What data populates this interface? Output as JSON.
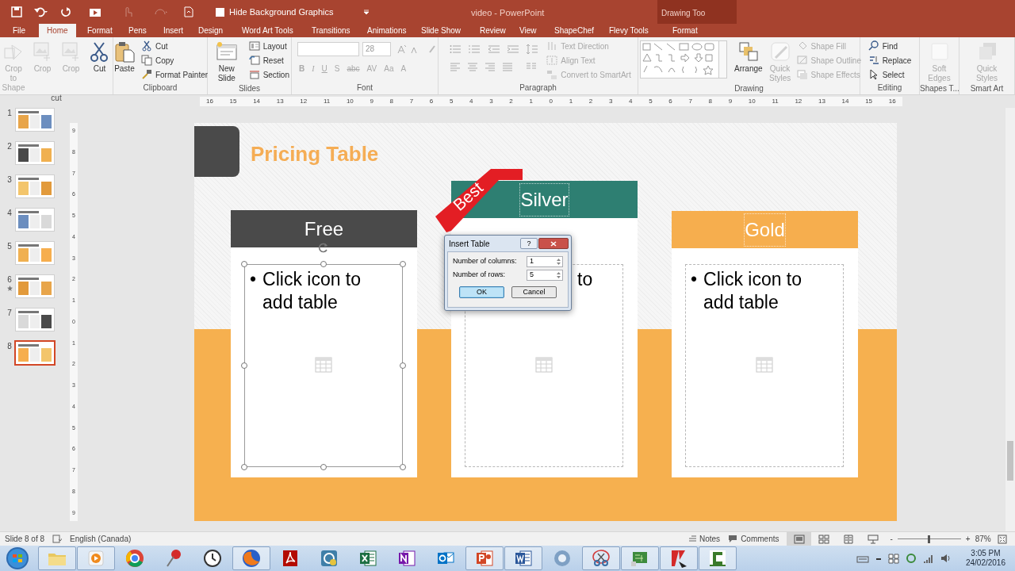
{
  "title_bar": {
    "hide_background": {
      "label": "Hide Background Graphics",
      "checked": false
    },
    "title": "video - PowerPoint",
    "contextual": "Drawing Too"
  },
  "tabs": [
    {
      "label": "File",
      "selected": false
    },
    {
      "label": "Home",
      "selected": true
    },
    {
      "label": "Format",
      "selected": false
    },
    {
      "label": "Pens",
      "selected": false
    },
    {
      "label": "Insert",
      "selected": false
    },
    {
      "label": "Design",
      "selected": false
    },
    {
      "label": "Word Art Tools",
      "selected": false
    },
    {
      "label": "Transitions",
      "selected": false
    },
    {
      "label": "Animations",
      "selected": false
    },
    {
      "label": "Slide Show",
      "selected": false
    },
    {
      "label": "Review",
      "selected": false
    },
    {
      "label": "View",
      "selected": false
    },
    {
      "label": "ShapeChef",
      "selected": false
    },
    {
      "label": "Flevy Tools",
      "selected": false
    },
    {
      "label": "Format",
      "selected": false
    }
  ],
  "ribbon": [
    {
      "label": "cut",
      "items": [
        {
          "kind": "large",
          "label": "Crop to Shape",
          "disabled": true
        },
        {
          "kind": "large",
          "label": "Crop",
          "disabled": true
        },
        {
          "kind": "large",
          "label": "Crop",
          "disabled": true
        },
        {
          "kind": "large",
          "label": "Cut",
          "disabled": false
        }
      ]
    },
    {
      "label": "Clipboard",
      "items": [
        {
          "kind": "large",
          "label": "Paste",
          "disabled": false
        },
        {
          "kind": "small",
          "label": "Cut",
          "disabled": false
        },
        {
          "kind": "small",
          "label": "Copy",
          "disabled": false
        },
        {
          "kind": "small",
          "label": "Format Painter",
          "disabled": false
        }
      ]
    },
    {
      "label": "Slides",
      "items": [
        {
          "kind": "large",
          "label": "New Slide",
          "disabled": false
        },
        {
          "kind": "small",
          "label": "Layout",
          "disabled": false
        },
        {
          "kind": "small",
          "label": "Reset",
          "disabled": false
        },
        {
          "kind": "small",
          "label": "Section",
          "disabled": false
        }
      ]
    },
    {
      "label": "Font",
      "kind": "font",
      "font_size": "28",
      "buttons": [
        "B",
        "I",
        "U",
        "S",
        "abc",
        "AV",
        "Aa",
        "A"
      ]
    },
    {
      "label": "Paragraph",
      "kind": "paragraph",
      "items": [
        {
          "kind": "small",
          "label": "Text Direction",
          "disabled": true
        },
        {
          "kind": "small",
          "label": "Align Text",
          "disabled": true
        },
        {
          "kind": "small",
          "label": "Convert to SmartArt",
          "disabled": true
        }
      ]
    },
    {
      "label": "Drawing",
      "kind": "drawing",
      "items": [
        {
          "kind": "large",
          "label": "Arrange",
          "disabled": false
        },
        {
          "kind": "large",
          "label": "Quick Styles",
          "disabled": true
        },
        {
          "kind": "small",
          "label": "Shape Fill",
          "disabled": true
        },
        {
          "kind": "small",
          "label": "Shape Outline",
          "disabled": true
        },
        {
          "kind": "small",
          "label": "Shape Effects",
          "disabled": true
        }
      ]
    },
    {
      "label": "Editing",
      "items": [
        {
          "kind": "small",
          "label": "Find",
          "disabled": false
        },
        {
          "kind": "small",
          "label": "Replace",
          "disabled": false
        },
        {
          "kind": "small",
          "label": "Select",
          "disabled": false
        }
      ]
    },
    {
      "label": "Shapes T...",
      "items": [
        {
          "kind": "large",
          "label": "Soft Edges",
          "disabled": true
        }
      ]
    },
    {
      "label": "Smart Art",
      "items": [
        {
          "kind": "large",
          "label": "Quick Styles",
          "disabled": true
        }
      ]
    }
  ],
  "ruler": {
    "horizontal": [
      "16",
      "15",
      "14",
      "13",
      "12",
      "11",
      "10",
      "9",
      "8",
      "7",
      "6",
      "5",
      "4",
      "3",
      "2",
      "1",
      "0",
      "1",
      "2",
      "3",
      "4",
      "5",
      "6",
      "7",
      "8",
      "9",
      "10",
      "11",
      "12",
      "13",
      "14",
      "15",
      "16"
    ],
    "vertical": [
      "9",
      "8",
      "7",
      "6",
      "5",
      "4",
      "3",
      "2",
      "1",
      "0",
      "1",
      "2",
      "3",
      "4",
      "5",
      "6",
      "7",
      "8",
      "9"
    ]
  },
  "slides": [
    {
      "number": "1",
      "selected": false,
      "animated": false
    },
    {
      "number": "2",
      "selected": false,
      "animated": false
    },
    {
      "number": "3",
      "selected": false,
      "animated": false
    },
    {
      "number": "4",
      "selected": false,
      "animated": false
    },
    {
      "number": "5",
      "selected": false,
      "animated": false
    },
    {
      "number": "6",
      "selected": false,
      "animated": true
    },
    {
      "number": "7",
      "selected": false,
      "animated": false
    },
    {
      "number": "8",
      "selected": true,
      "animated": false
    }
  ],
  "slide": {
    "title": "Pricing Table",
    "columns": [
      {
        "name": "Free",
        "color": "#4a4a4a",
        "bullet": "•",
        "placeholder": "Click icon to add table",
        "selected": true
      },
      {
        "name": "Silver",
        "color": "#2e7f72",
        "placeholder": "to",
        "badge": "Best",
        "selected": false
      },
      {
        "name": "Gold",
        "color": "#f6ae4e",
        "bullet": "•",
        "placeholder": "Click icon to add table",
        "selected": false
      }
    ]
  },
  "dialog": {
    "title": "Insert Table",
    "help": "?",
    "fields": [
      {
        "label": "Number of columns:",
        "value": "1"
      },
      {
        "label": "Number of rows:",
        "value": "5"
      }
    ],
    "buttons": [
      {
        "label": "OK",
        "focused": true
      },
      {
        "label": "Cancel",
        "focused": false
      }
    ]
  },
  "status_bar": {
    "slide_info": "Slide 8 of 8",
    "language": "English (Canada)",
    "notes": "Notes",
    "comments": "Comments",
    "views": [
      {
        "selected": true
      },
      {
        "selected": false
      },
      {
        "selected": false
      },
      {
        "selected": false
      }
    ],
    "zoom": {
      "out": "-",
      "in": "+",
      "level": 0.5,
      "reading": "87%"
    }
  },
  "taskbar": {
    "apps": [
      {
        "running": true
      },
      {
        "running": true
      },
      {
        "running": false
      },
      {
        "running": false
      },
      {
        "running": false
      },
      {
        "running": true
      },
      {
        "running": false
      },
      {
        "running": false
      },
      {
        "running": false
      },
      {
        "running": false
      },
      {
        "running": false
      },
      {
        "running": true
      },
      {
        "running": true
      },
      {
        "running": false
      },
      {
        "running": true
      },
      {
        "running": true
      },
      {
        "running": true
      },
      {
        "running": true
      }
    ],
    "time": "3:05 PM",
    "date": "24/02/2016"
  }
}
